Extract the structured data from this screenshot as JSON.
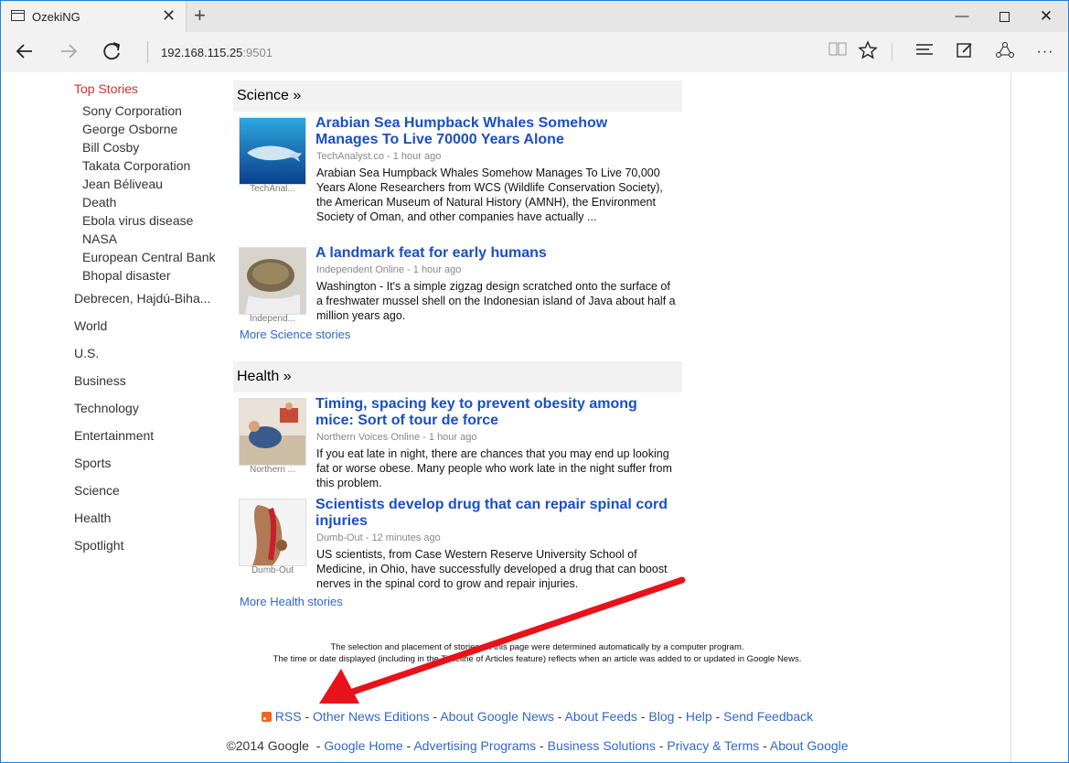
{
  "browser": {
    "tab_title": "OzekiNG",
    "tab_close": "✕",
    "new_tab": "+",
    "window_controls": {
      "minimize": "—",
      "close": "✕"
    },
    "address_host": "192.168.115.25",
    "address_port": ":9501",
    "icons": [
      "back-arrow-icon",
      "forward-arrow-icon",
      "refresh-icon",
      "reading-view-icon",
      "favorite-star-icon",
      "hub-icon",
      "web-note-icon",
      "share-icon",
      "more-icon"
    ]
  },
  "sidebar": {
    "top_stories": "Top Stories",
    "top_items": [
      "Sony Corporation",
      "George Osborne",
      "Bill Cosby",
      "Takata Corporation",
      "Jean Béliveau",
      "Death",
      "Ebola virus disease",
      "NASA",
      "European Central Bank",
      "Bhopal disaster"
    ],
    "sections": [
      "Debrecen, Hajdú-Biha...",
      "World",
      "U.S.",
      "Business",
      "Technology",
      "Entertainment",
      "Sports",
      "Science",
      "Health",
      "Spotlight"
    ]
  },
  "science": {
    "heading": "Science »",
    "articles": [
      {
        "title": "Arabian Sea Humpback Whales Somehow Manages To Live 70000 Years Alone",
        "source": "TechAnalyst.co - 1 hour ago",
        "thumb_caption": "TechAnal...",
        "snippet": "Arabian Sea Humpback Whales Somehow Manages To Live 70,000 Years Alone Researchers from WCS (Wildlife Conservation Society), the American Museum of Natural History (AMNH), the Environment Society of Oman, and other companies have actually ..."
      },
      {
        "title": "A landmark feat for early humans",
        "source": "Independent Online - 1 hour ago",
        "thumb_caption": "Independ...",
        "snippet": "Washington - It's a simple zigzag design scratched onto the surface of a freshwater mussel shell on the Indonesian island of Java about half a million years ago."
      }
    ],
    "more": "More Science stories"
  },
  "health": {
    "heading": "Health »",
    "articles": [
      {
        "title": "Timing, spacing key to prevent obesity among mice: Sort of tour de force",
        "source": "Northern Voices Online - 1 hour ago",
        "thumb_caption": "Northern ...",
        "snippet": "If you eat late in night, there are chances that you may end up looking fat or worse obese. Many people who work late in the night suffer from this problem."
      },
      {
        "title": "Scientists develop drug that can repair spinal cord injuries",
        "source": "Dumb-Out - 12 minutes ago",
        "thumb_caption": "Dumb-Out",
        "snippet": "US scientists, from Case Western Reserve University School of Medicine, in Ohio, have successfully developed a drug that can boost nerves in the spinal cord to grow and repair injuries."
      }
    ],
    "more": "More Health stories"
  },
  "disclaimer": {
    "line1": "The selection and placement of stories on this page were determined automatically by a computer program.",
    "line2": "The time or date displayed (including in the Timeline of Articles feature) reflects when an article was added to or updated in Google News."
  },
  "footer": {
    "rss": "RSS",
    "other_editions": "Other News Editions",
    "about_news": "About Google News",
    "about_feeds": "About Feeds",
    "blog": "Blog",
    "help": "Help",
    "feedback": "Send Feedback",
    "copyright": "©2014 Google",
    "google_home": "Google Home",
    "advertising": "Advertising Programs",
    "business": "Business Solutions",
    "privacy": "Privacy & Terms",
    "about_google": "About Google",
    "separator": " - "
  },
  "annotation_color": "#e8121a"
}
